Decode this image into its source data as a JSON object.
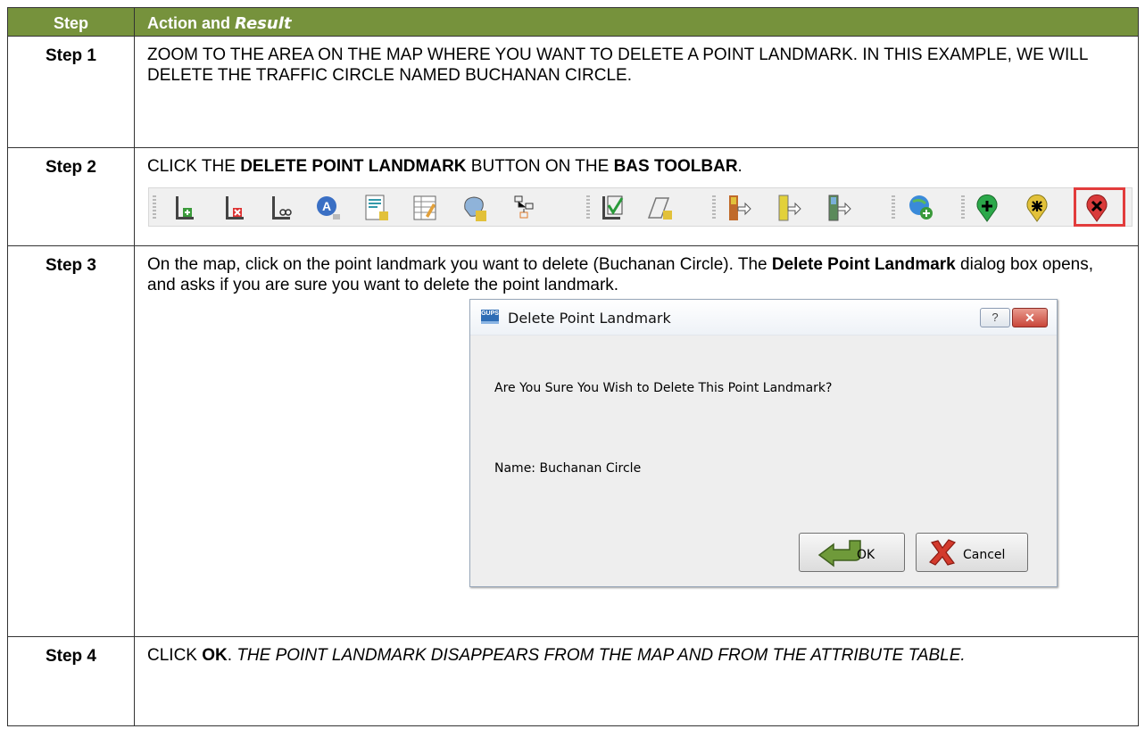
{
  "header": {
    "step_col": "Step",
    "action_col": "Action and ",
    "action_col_italic": "Result"
  },
  "rows": [
    {
      "step": "Step 1",
      "text": "ZOOM TO THE AREA ON THE MAP WHERE YOU WANT TO DELETE A POINT LANDMARK. IN THIS EXAMPLE, WE WILL DELETE THE TRAFFIC CIRCLE NAMED BUCHANAN CIRCLE."
    },
    {
      "step": "Step 2",
      "text_pre": "CLICK THE ",
      "text_bold1": "DELETE POINT LANDMARK",
      "text_mid": " BUTTON ON THE ",
      "text_bold2": "BAS TOOLBAR",
      "text_post": "."
    },
    {
      "step": "Step 3",
      "text_pre": "On the map, click on the point landmark you want to delete (Buchanan Circle). The ",
      "text_bold": "Delete Point Landmark",
      "text_post": " dialog box opens, and asks if you are sure you want to delete the point landmark."
    },
    {
      "step": "Step 4",
      "text_pre": "CLICK ",
      "text_bold": "OK",
      "text_mid": ". ",
      "text_italic": "THE POINT LANDMARK DISAPPEARS FROM THE MAP AND FROM THE ATTRIBUTE TABLE."
    }
  ],
  "toolbar_icons": [
    "add-line-icon",
    "delete-line-icon",
    "split-line-icon",
    "address-icon",
    "edit-attributes-icon",
    "attribute-table-icon",
    "identify-icon",
    "topology-icon",
    "validate-icon",
    "edit-polygon-icon",
    "boundary-add-icon",
    "boundary-edit-icon",
    "boundary-remove-icon",
    "add-layer-icon",
    "add-point-landmark-icon",
    "edit-point-landmark-icon",
    "delete-point-landmark-icon"
  ],
  "dialog": {
    "app_icon": "GUPS",
    "title": "Delete Point Landmark",
    "help_glyph": "?",
    "close_glyph": "✕",
    "question": "Are You Sure You Wish to Delete This Point Landmark?",
    "name_line": "Name: Buchanan Circle",
    "ok_label": "OK",
    "cancel_label": "Cancel"
  },
  "colors": {
    "header_bg": "#76923c",
    "highlight": "#e23c3c"
  }
}
